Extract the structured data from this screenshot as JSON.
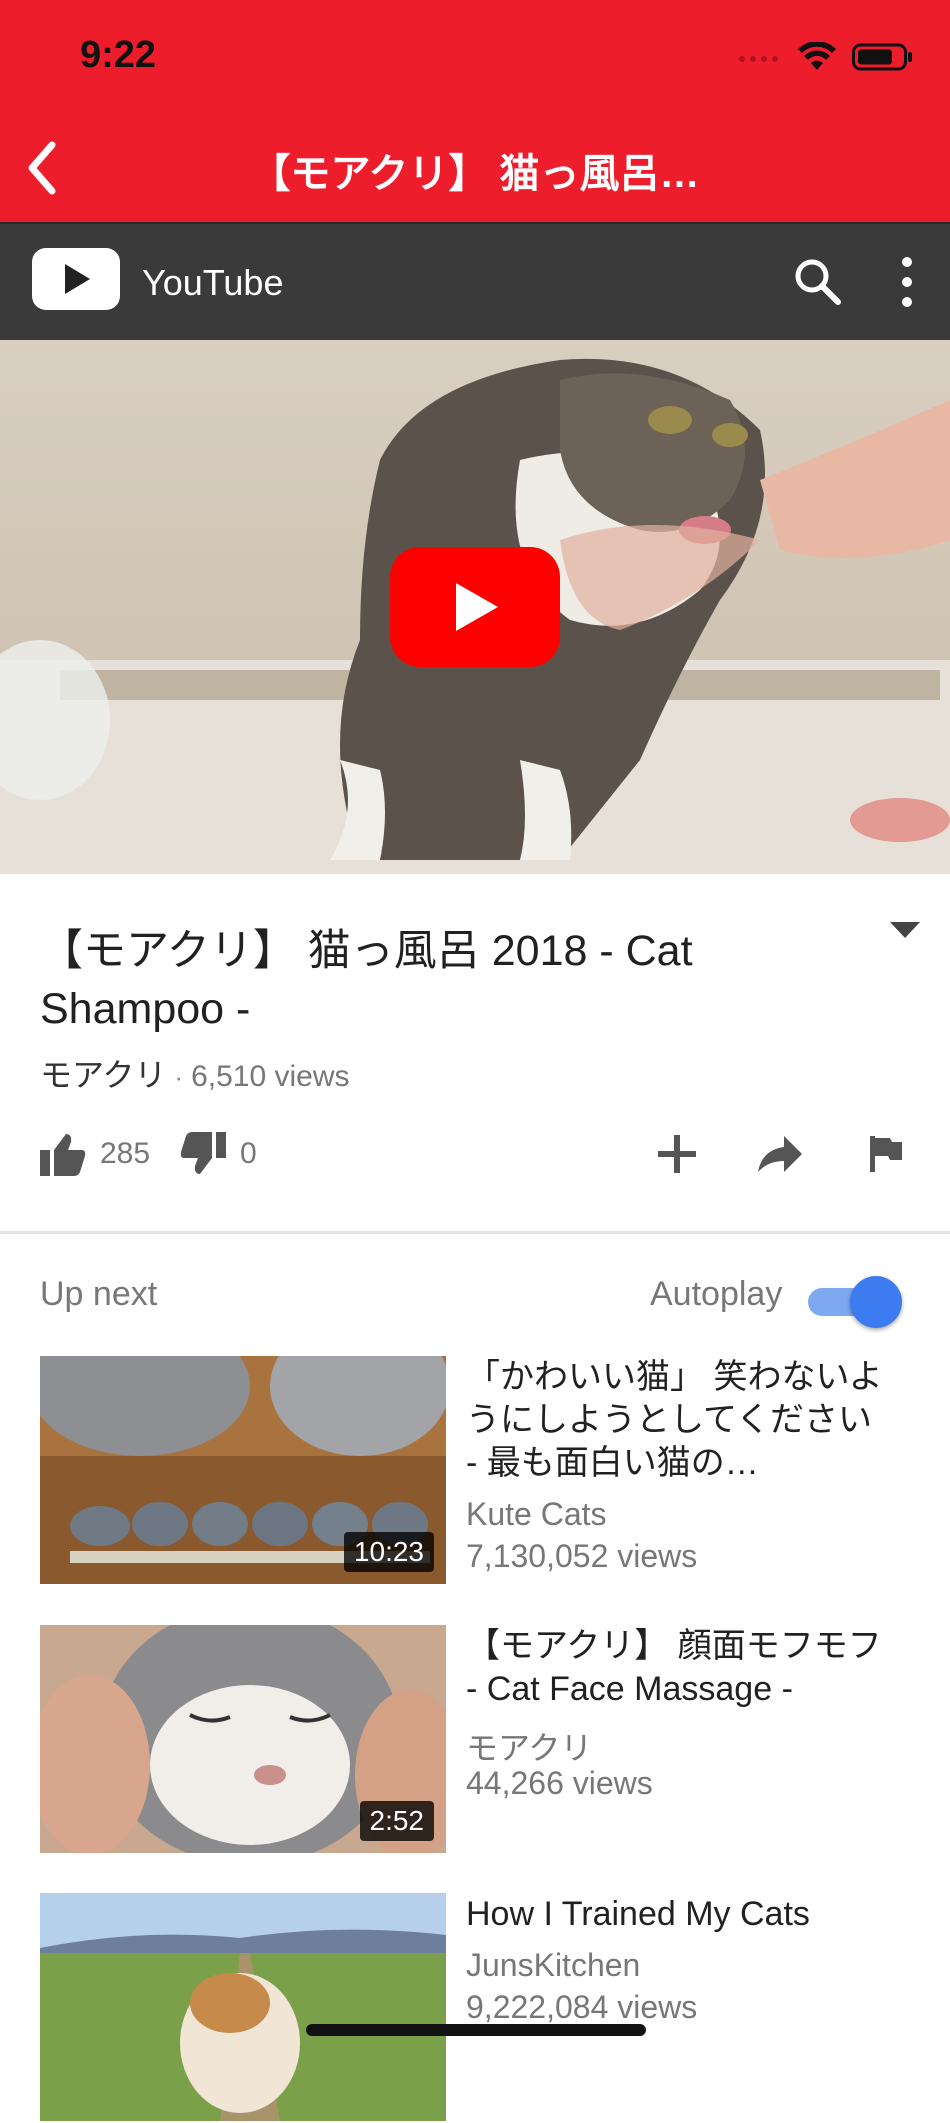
{
  "status_bar": {
    "time": "9:22"
  },
  "nav": {
    "title": "【モアクリ】 猫っ風呂…"
  },
  "youtube_header": {
    "brand": "YouTube"
  },
  "video": {
    "title": "【モアクリ】 猫っ風呂 2018 - Cat Shampoo -",
    "channel": "モアクリ",
    "separator": "·",
    "views": "6,510 views",
    "likes": "285",
    "dislikes": "0"
  },
  "up_next": {
    "label": "Up next",
    "autoplay_label": "Autoplay",
    "autoplay_on": true,
    "items": [
      {
        "title": "「かわいい猫」 笑わないようにしようとしてください - 最も面白い猫の…",
        "channel": "Kute Cats",
        "views": "7,130,052 views",
        "duration": "10:23"
      },
      {
        "title": "【モアクリ】 顔面モフモフ - Cat Face Massage -",
        "channel": "モアクリ",
        "views": "44,266 views",
        "duration": "2:52"
      },
      {
        "title": "How I Trained My Cats",
        "channel": "JunsKitchen",
        "views": "9,222,084 views",
        "duration": ""
      }
    ]
  },
  "colors": {
    "accent": "#ee1d2c",
    "youtube_bar": "#3a3a3a",
    "toggle": "#3d7cf0"
  }
}
